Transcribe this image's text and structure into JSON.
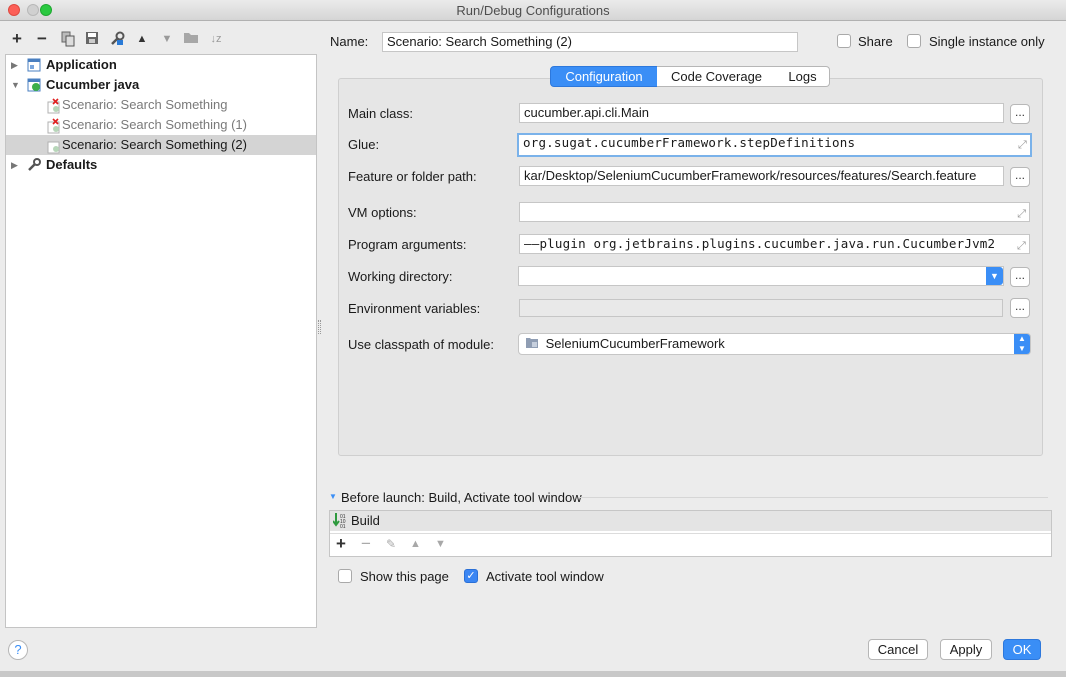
{
  "window": {
    "title": "Run/Debug Configurations"
  },
  "toolbar": {
    "add": "+",
    "remove": "−"
  },
  "tree": {
    "application": "Application",
    "cucumber_java": "Cucumber java",
    "items": [
      "Scenario: Search Something",
      "Scenario: Search Something (1)",
      "Scenario: Search Something (2)"
    ],
    "defaults": "Defaults"
  },
  "header": {
    "name_label": "Name:",
    "name_value": "Scenario: Search Something (2)",
    "share_label": "Share",
    "single_instance_label": "Single instance only"
  },
  "tabs": {
    "configuration": "Configuration",
    "code_coverage": "Code Coverage",
    "logs": "Logs"
  },
  "form": {
    "main_class_label": "Main class:",
    "main_class_value": "cucumber.api.cli.Main",
    "glue_label": "Glue:",
    "glue_value": "org.sugat.cucumberFramework.stepDefinitions",
    "feature_label": "Feature or folder path:",
    "feature_value": "kar/Desktop/SeleniumCucumberFramework/resources/features/Search.feature",
    "vm_label": "VM options:",
    "vm_value": "",
    "program_args_label": "Program arguments:",
    "program_args_value": "——plugin org.jetbrains.plugins.cucumber.java.run.CucumberJvm2",
    "working_dir_label": "Working directory:",
    "working_dir_value": "",
    "env_label": "Environment variables:",
    "env_value": "",
    "classpath_label": "Use classpath of module:",
    "classpath_value": "SeleniumCucumberFramework",
    "dots": "..."
  },
  "before_launch": {
    "title": "Before launch: Build, Activate tool window",
    "items": [
      "Build"
    ],
    "add": "+",
    "remove": "−"
  },
  "options": {
    "show_page_label": "Show this page",
    "activate_tool_label": "Activate tool window"
  },
  "footer": {
    "help": "?",
    "cancel": "Cancel",
    "apply": "Apply",
    "ok": "OK"
  }
}
